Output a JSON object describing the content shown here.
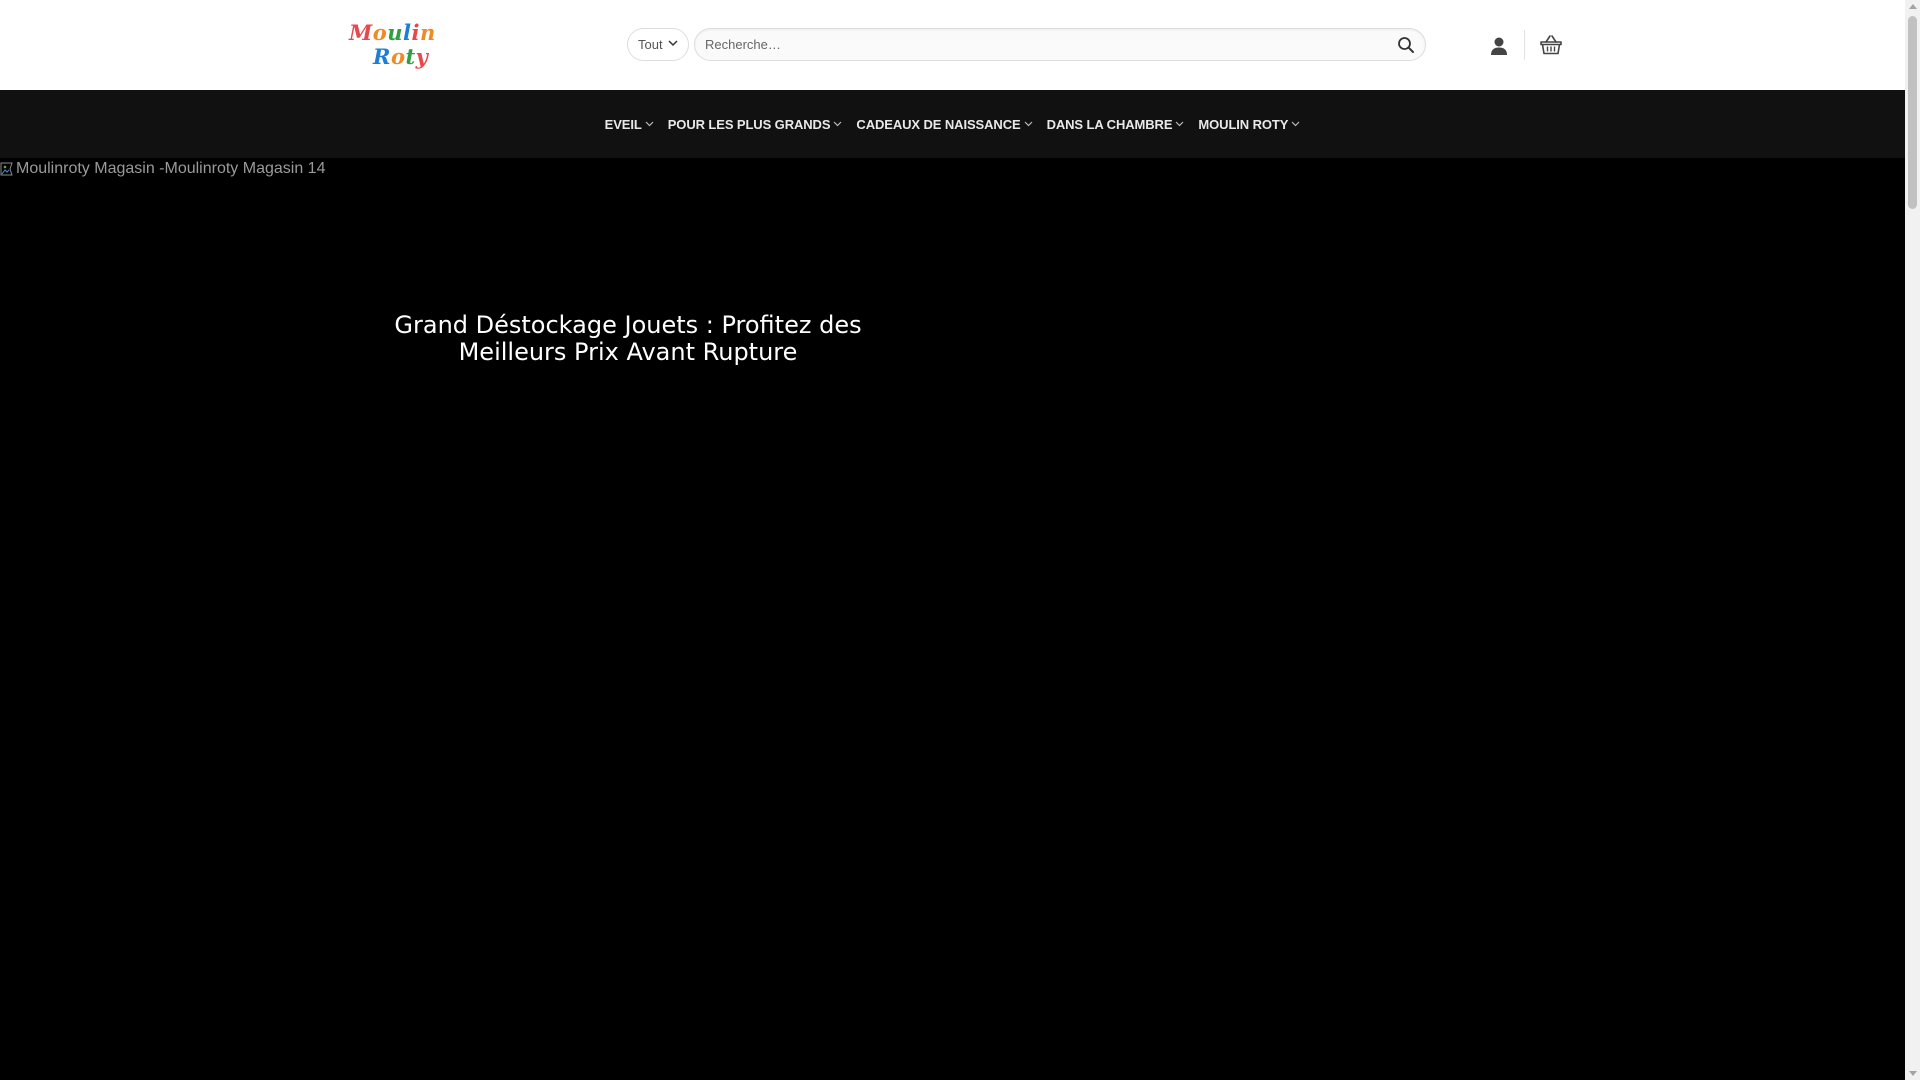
{
  "header": {
    "logo": {
      "line1": [
        "M",
        "o",
        "u",
        "l",
        "i",
        "n"
      ],
      "line2": [
        "R",
        "o",
        "t",
        "y"
      ],
      "colors1": [
        "#e5484d",
        "#f08a24",
        "#2f9e44",
        "#1c7ed6",
        "#e5484d",
        "#f08a24"
      ],
      "colors2": [
        "#1c7ed6",
        "#f08a24",
        "#2f9e44",
        "#e5484d"
      ]
    },
    "category_select": {
      "value": "Tout",
      "icon": "chevron-down-icon"
    },
    "search": {
      "placeholder": "Recherche…",
      "value": "",
      "icon": "search-icon"
    },
    "icons": {
      "account": "user-icon",
      "cart": "basket-icon"
    }
  },
  "nav": {
    "items": [
      {
        "label": "EVEIL"
      },
      {
        "label": "POUR LES PLUS GRANDS"
      },
      {
        "label": "CADEAUX DE NAISSANCE"
      },
      {
        "label": "DANS LA CHAMBRE"
      },
      {
        "label": "MOULIN ROTY"
      }
    ]
  },
  "hero": {
    "image_alt": "Moulinroty Magasin -Moulinroty Magasin 14",
    "title": "Grand Déstockage Jouets : Profitez des Meilleurs Prix Avant Rupture"
  },
  "colors": {
    "header_bg": "#ffffff",
    "nav_bg": "#111111",
    "hero_bg": "#000000",
    "nav_text": "#e9e9e9"
  }
}
